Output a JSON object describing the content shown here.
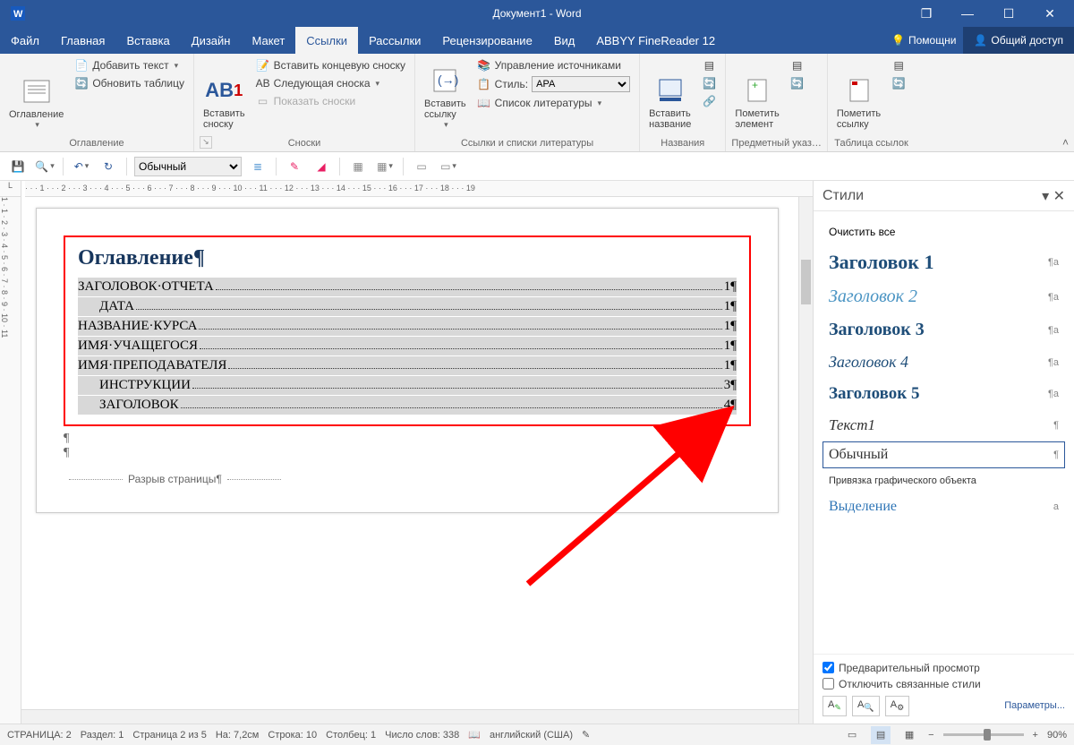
{
  "title": "Документ1 - Word",
  "window": {
    "restore": "❐",
    "min": "—",
    "max": "☐",
    "close": "✕"
  },
  "tabs": [
    "Файл",
    "Главная",
    "Вставка",
    "Дизайн",
    "Макет",
    "Ссылки",
    "Рассылки",
    "Рецензирование",
    "Вид",
    "ABBYY FineReader 12"
  ],
  "active_tab": 5,
  "help_text": "Помощни",
  "share_text": "Общий доступ",
  "ribbon": {
    "g1": {
      "label": "Оглавление",
      "big": "Оглавление",
      "add_text": "Добавить текст",
      "update": "Обновить таблицу"
    },
    "g2": {
      "label": "Сноски",
      "big": "Вставить\nсноску",
      "ab": "AB",
      "end": "Вставить концевую сноску",
      "next": "Следующая сноска",
      "show": "Показать сноски"
    },
    "g3": {
      "label": "Ссылки и списки литературы",
      "big": "Вставить\nссылку",
      "mg": "Управление источниками",
      "style_l": "Стиль:",
      "style_v": "APA",
      "bib": "Список литературы"
    },
    "g4": {
      "label": "Названия",
      "big": "Вставить\nназвание"
    },
    "g5": {
      "label": "Предметный указ…",
      "big": "Пометить\nэлемент"
    },
    "g6": {
      "label": "Таблица ссылок",
      "big": "Пометить\nссылку"
    }
  },
  "qat_style": "Обычный",
  "ruler_h": "· · · 1 · · · 2 · · · 3 · · · 4 · · · 5 · · · 6 · · · 7 · · · 8 · · · 9 · · · 10 · · · 11 · · · 12 · · · 13 · · · 14 · · · 15 · · · 16 · · · 17 · · · 18 · · · 19",
  "ruler_v": "1 · 1 · 2 · 3 · 4 · 5 · 6 · 7 · 8 · 9 · 10 · 11",
  "doc": {
    "toc_title": "Оглавление",
    "rows": [
      {
        "t": "ЗАГОЛОВОК·ОТЧЕТА",
        "p": "1",
        "l": 1
      },
      {
        "t": "ДАТА",
        "p": "1",
        "l": 2
      },
      {
        "t": "НАЗВАНИЕ·КУРСА",
        "p": "1",
        "l": 1
      },
      {
        "t": "ИМЯ·УЧАЩЕГОСЯ",
        "p": "1",
        "l": 1
      },
      {
        "t": "ИМЯ·ПРЕПОДАВАТЕЛЯ",
        "p": "1",
        "l": 1
      },
      {
        "t": "ИНСТРУКЦИИ",
        "p": "3",
        "l": 2
      },
      {
        "t": "ЗАГОЛОВОК",
        "p": "4",
        "l": 2
      }
    ],
    "page_break": "Разрыв страницы"
  },
  "styles_pane": {
    "title": "Стили",
    "clear": "Очистить все",
    "items": [
      {
        "t": "Заголовок 1",
        "cls": "h1",
        "sym": "¶a"
      },
      {
        "t": "Заголовок 2",
        "cls": "h2",
        "sym": "¶a"
      },
      {
        "t": "Заголовок 3",
        "cls": "h3",
        "sym": "¶a"
      },
      {
        "t": "Заголовок 4",
        "cls": "h4",
        "sym": "¶a"
      },
      {
        "t": "Заголовок 5",
        "cls": "h5",
        "sym": "¶a"
      },
      {
        "t": "Текст1",
        "cls": "tx1",
        "sym": "¶"
      },
      {
        "t": "Обычный",
        "cls": "norm",
        "sym": "¶",
        "selected": true
      },
      {
        "t": "Привязка графического объекта",
        "cls": "anchor-s",
        "sym": ""
      },
      {
        "t": "Выделение",
        "cls": "sel-s",
        "sym": "a"
      }
    ],
    "preview": "Предварительный просмотр",
    "linked": "Отключить связанные стили",
    "params": "Параметры..."
  },
  "status": {
    "page": "СТРАНИЦА: 2",
    "section": "Раздел: 1",
    "pageof": "Страница 2 из 5",
    "at": "На: 7,2см",
    "line": "Строка: 10",
    "col": "Столбец: 1",
    "words": "Число слов: 338",
    "lang": "английский (США)",
    "zoom": "90%"
  }
}
